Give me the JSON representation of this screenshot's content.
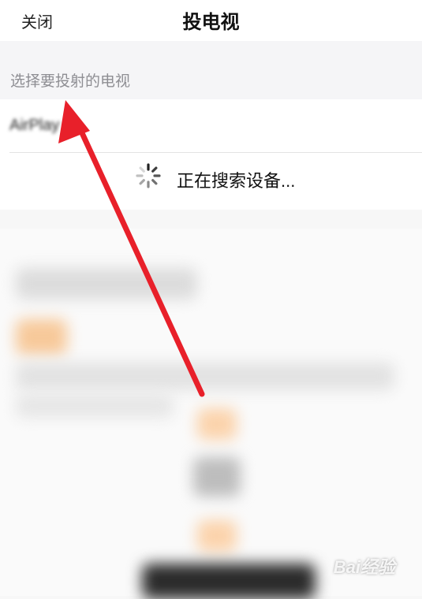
{
  "nav": {
    "close_label": "关闭",
    "title": "投电视"
  },
  "section": {
    "label": "选择要投射的电视"
  },
  "devices": [
    {
      "name": "AirPlay"
    }
  ],
  "status": {
    "searching_text": "正在搜索设备..."
  },
  "watermark": {
    "text": "Bai经验"
  },
  "colors": {
    "annotation_arrow": "#e8202a",
    "secondary_text": "#8e8e93"
  }
}
